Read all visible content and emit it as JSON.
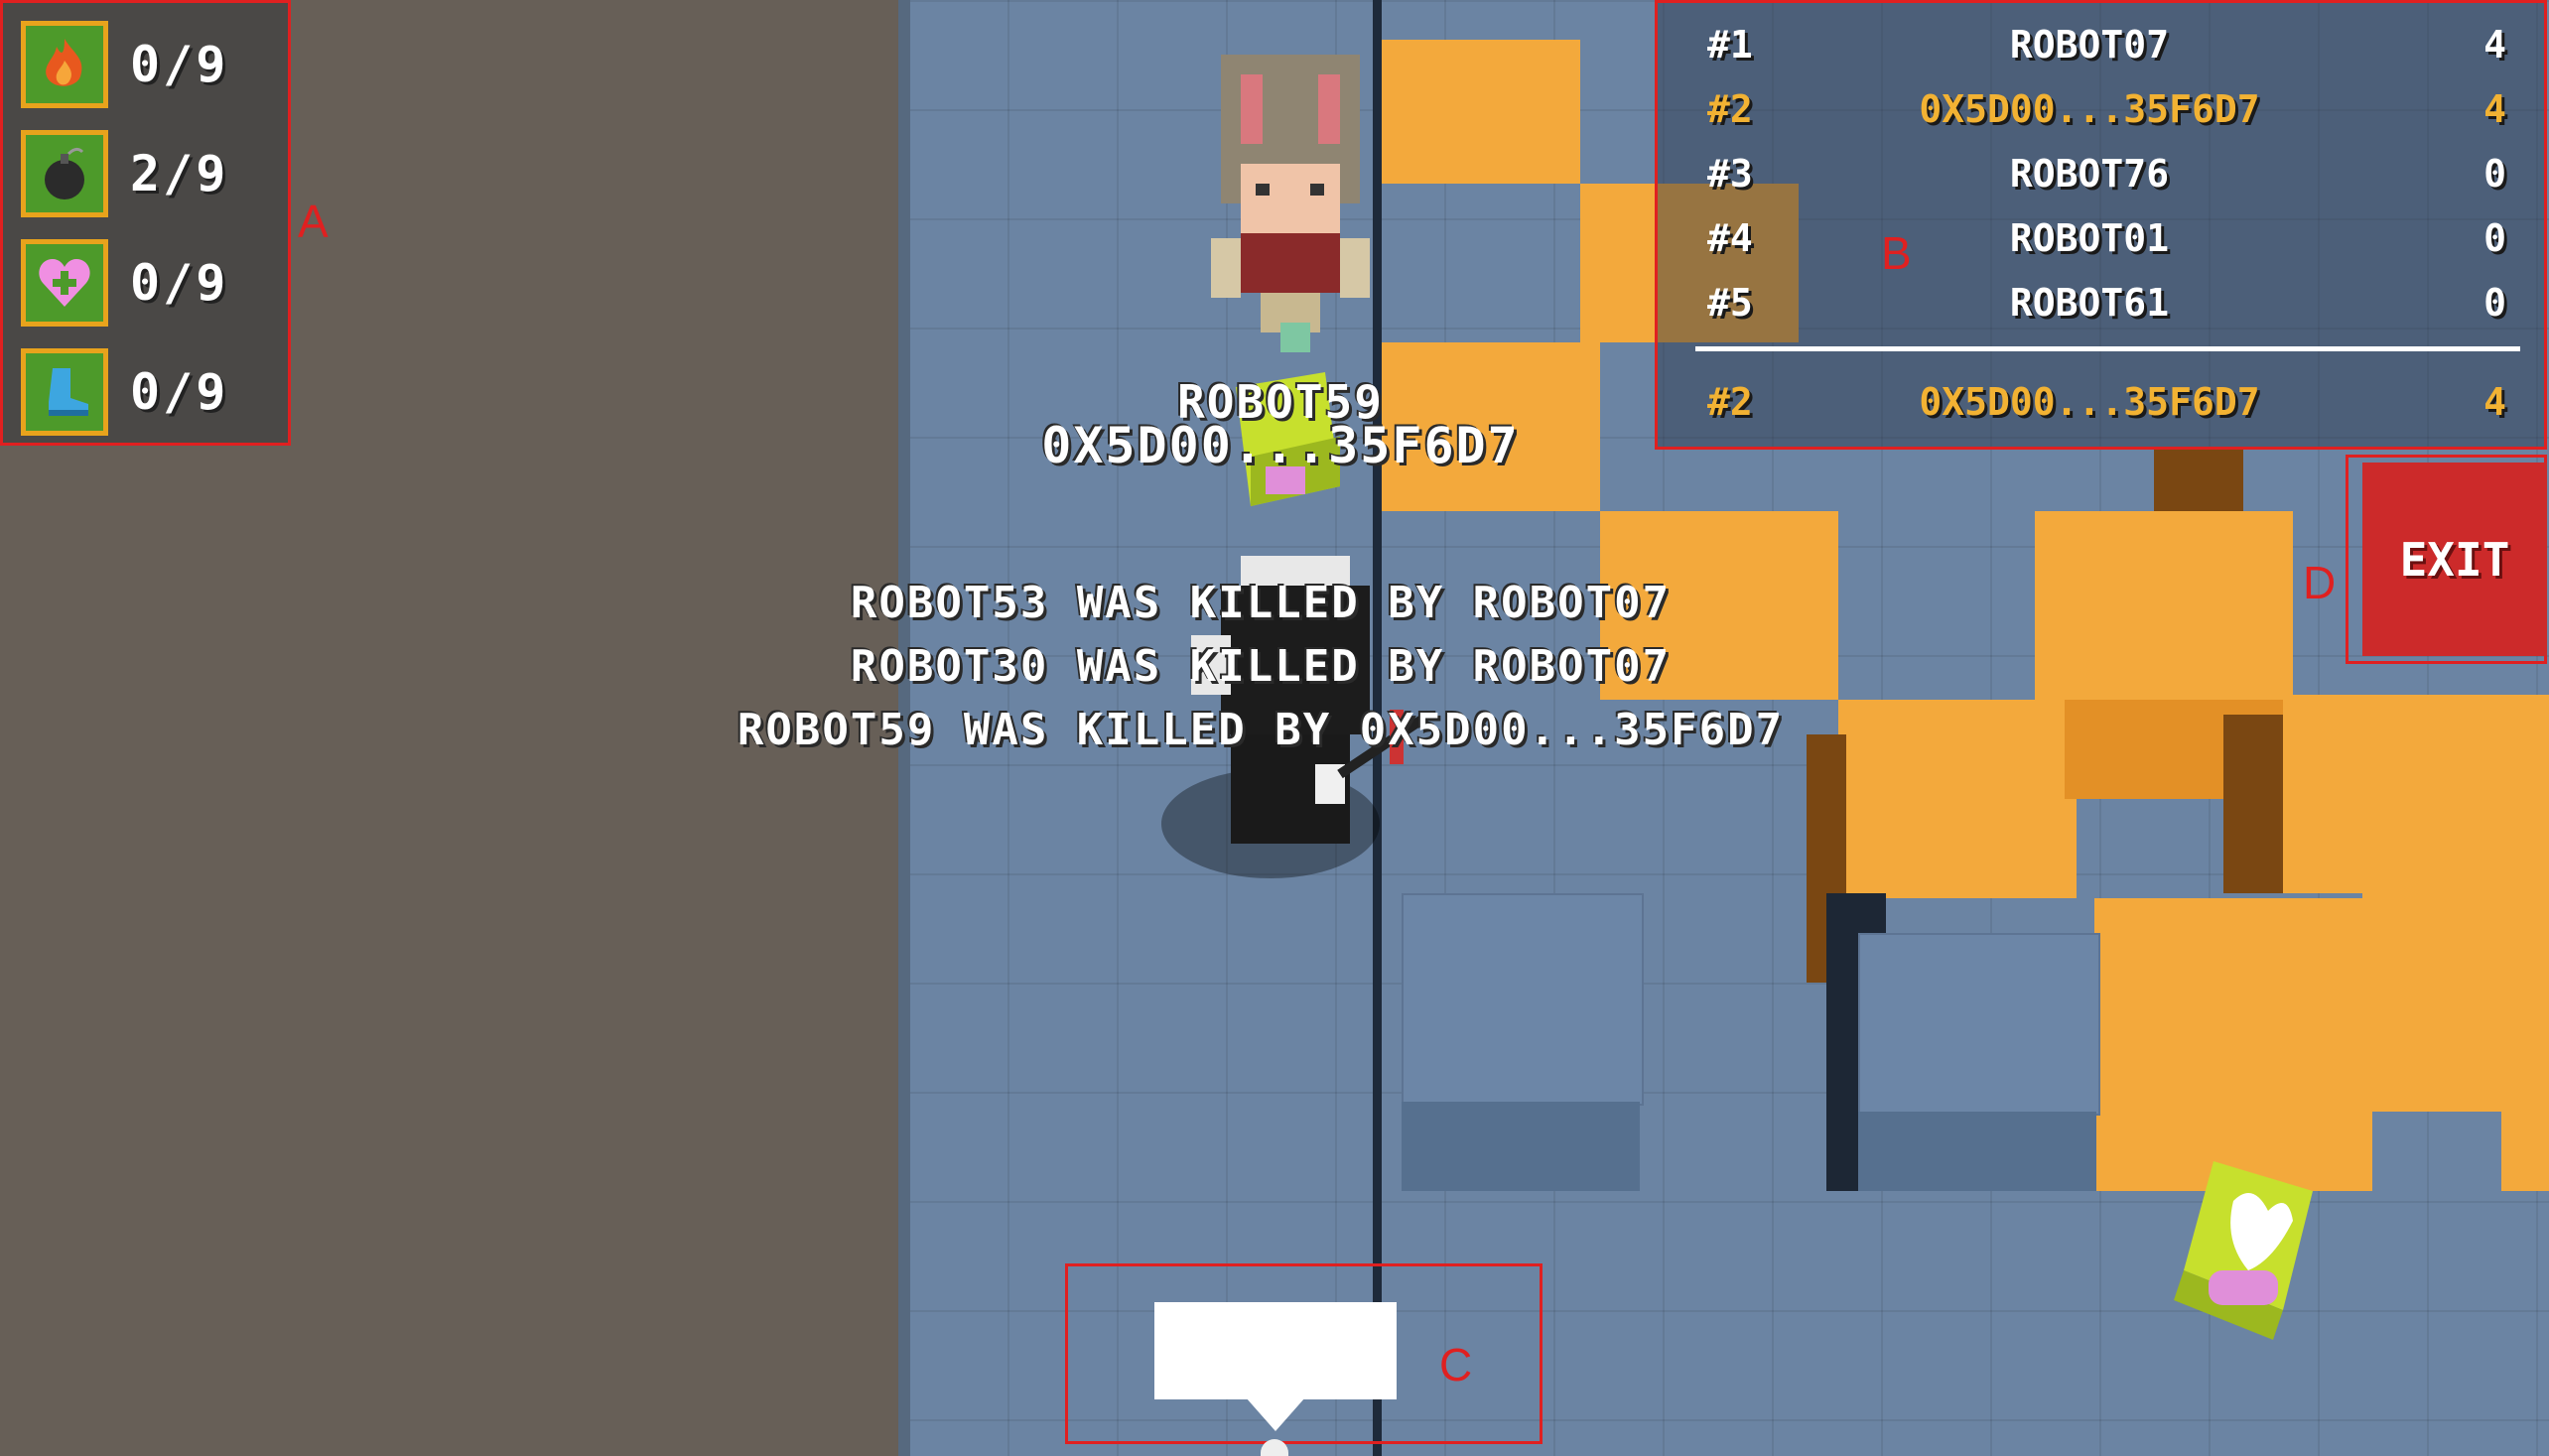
{
  "hud": {
    "items": [
      {
        "icon": "fire-icon",
        "count": "0/9"
      },
      {
        "icon": "bomb-icon",
        "count": "2/9"
      },
      {
        "icon": "heart-icon",
        "count": "0/9"
      },
      {
        "icon": "boot-icon",
        "count": "0/9"
      }
    ]
  },
  "leaderboard": {
    "rows": [
      {
        "rank": "#1",
        "name": "ROBOT07",
        "score": "4",
        "highlight": false
      },
      {
        "rank": "#2",
        "name": "0X5D00...35F6D7",
        "score": "4",
        "highlight": true
      },
      {
        "rank": "#3",
        "name": "ROBOT76",
        "score": "0",
        "highlight": false
      },
      {
        "rank": "#4",
        "name": "ROBOT01",
        "score": "0",
        "highlight": false
      },
      {
        "rank": "#5",
        "name": "ROBOT61",
        "score": "0",
        "highlight": false
      }
    ],
    "self": {
      "rank": "#2",
      "name": "0X5D00...35F6D7",
      "score": "4"
    }
  },
  "exit_label": "EXIT",
  "name_tags": {
    "enemy": "ROBOT59",
    "player": "0X5D00...35F6D7"
  },
  "kill_feed": [
    "ROBOT53 WAS KILLED BY ROBOT07",
    "ROBOT30 WAS KILLED BY ROBOT07",
    "ROBOT59 WAS KILLED BY 0X5D00...35F6D7"
  ],
  "annotations": {
    "a": "A",
    "b": "B",
    "c": "C",
    "d": "D"
  },
  "colors": {
    "highlight": "#f2b233",
    "exit": "#cc2a2a",
    "annotation": "#e02020"
  }
}
